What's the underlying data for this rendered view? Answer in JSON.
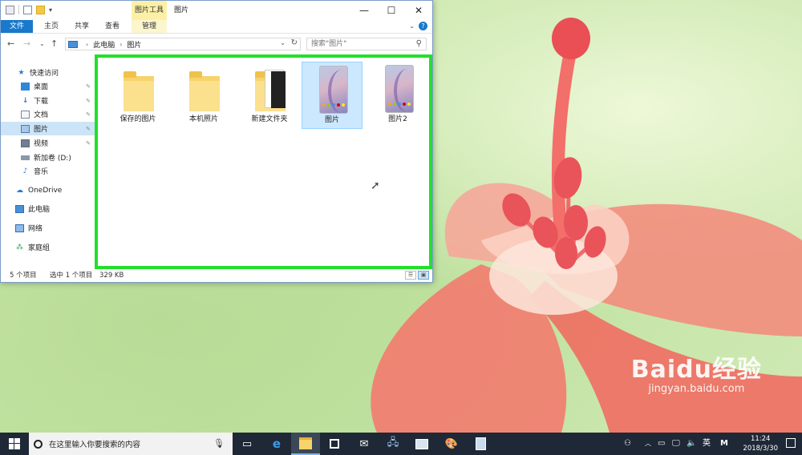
{
  "window": {
    "contextual_tab_header": "图片工具",
    "title": "图片",
    "ribbon_tabs": {
      "file": "文件",
      "home": "主页",
      "share": "共享",
      "view": "查看",
      "manage": "管理"
    },
    "address": {
      "crumbs": [
        "此电脑",
        "图片"
      ]
    },
    "search": {
      "placeholder": "搜索\"图片\""
    },
    "nav_items": [
      {
        "label": "快速访问",
        "icon": "star-icon",
        "pinned": false,
        "selected": false
      },
      {
        "label": "桌面",
        "icon": "desktop-icon",
        "pinned": true,
        "selected": false
      },
      {
        "label": "下载",
        "icon": "download-icon",
        "pinned": true,
        "selected": false
      },
      {
        "label": "文档",
        "icon": "document-icon",
        "pinned": true,
        "selected": false
      },
      {
        "label": "图片",
        "icon": "pictures-icon",
        "pinned": true,
        "selected": true
      },
      {
        "label": "视频",
        "icon": "video-icon",
        "pinned": true,
        "selected": false
      },
      {
        "label": "新加卷 (D:)",
        "icon": "drive-icon",
        "pinned": false,
        "selected": false
      },
      {
        "label": "音乐",
        "icon": "music-icon",
        "pinned": false,
        "selected": false
      },
      {
        "label": "OneDrive",
        "icon": "cloud-icon",
        "pinned": false,
        "selected": false
      },
      {
        "label": "此电脑",
        "icon": "computer-icon",
        "pinned": false,
        "selected": false
      },
      {
        "label": "网络",
        "icon": "network-icon",
        "pinned": false,
        "selected": false
      },
      {
        "label": "家庭组",
        "icon": "homegroup-icon",
        "pinned": false,
        "selected": false
      }
    ],
    "files": [
      {
        "name": "保存的图片",
        "type": "folder",
        "selected": false
      },
      {
        "name": "本机照片",
        "type": "folder",
        "selected": false
      },
      {
        "name": "新建文件夹",
        "type": "folder-with-content",
        "selected": false
      },
      {
        "name": "图片",
        "type": "image",
        "selected": true
      },
      {
        "name": "图片2",
        "type": "image",
        "selected": false
      }
    ],
    "status": {
      "count": "5 个项目",
      "selection": "选中 1 个项目",
      "size": "329 KB"
    }
  },
  "taskbar": {
    "search_placeholder": "在这里输入你要搜索的内容",
    "ime_label": "英",
    "ime_mode": "M",
    "time": "11:24",
    "date": "2018/3/30"
  },
  "watermark": {
    "logo": "Baidu经验",
    "url": "jingyan.baidu.com"
  },
  "colors": {
    "selection_highlight": "#22e02a",
    "taskbar": "#1f2836",
    "file_tab": "#1979ca",
    "contextual_tab": "#fbf0a6"
  }
}
